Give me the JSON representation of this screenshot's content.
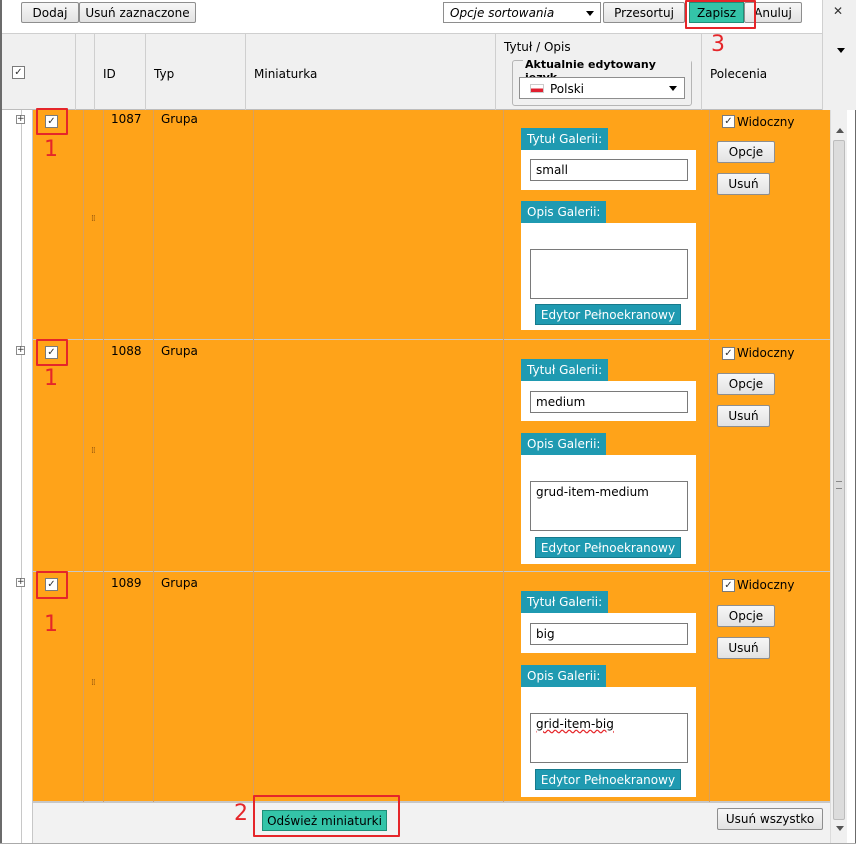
{
  "toolbar": {
    "add_label": "Dodaj",
    "remove_selected_label": "Usuń zaznaczone",
    "sort_options_label": "Opcje sortowania",
    "resort_label": "Przesortuj",
    "save_label": "Zapisz",
    "cancel_label": "Anuluj",
    "close_glyph": "✕"
  },
  "header": {
    "select_all_checked": "✓",
    "col_id": "ID",
    "col_type": "Typ",
    "col_thumbnail": "Miniaturka",
    "col_title_desc": "Tytuł / Opis",
    "lang_group_label": "Aktualnie edytowany język",
    "lang_value": "Polski",
    "col_commands": "Polecenia"
  },
  "rows": [
    {
      "id": "1087",
      "type": "Grupa",
      "title_tab": "Tytuł Galerii:",
      "title_value": "small",
      "desc_tab": "Opis Galerii:",
      "desc_value": "",
      "editor_label": "Edytor Pełnoekranowy",
      "visible_label": "Widoczny",
      "options_label": "Opcje",
      "remove_label": "Usuń",
      "check": "✓",
      "expander": "+",
      "annotation": "1"
    },
    {
      "id": "1088",
      "type": "Grupa",
      "title_tab": "Tytuł Galerii:",
      "title_value": "medium",
      "desc_tab": "Opis Galerii:",
      "desc_value": "grud-item-medium",
      "editor_label": "Edytor Pełnoekranowy",
      "visible_label": "Widoczny",
      "options_label": "Opcje",
      "remove_label": "Usuń",
      "check": "✓",
      "expander": "+",
      "annotation": "1"
    },
    {
      "id": "1089",
      "type": "Grupa",
      "title_tab": "Tytuł Galerii:",
      "title_value": "big",
      "desc_tab": "Opis Galerii:",
      "desc_value": "grid-item-big",
      "editor_label": "Edytor Pełnoekranowy",
      "visible_label": "Widoczny",
      "options_label": "Opcje",
      "remove_label": "Usuń",
      "check": "✓",
      "expander": "+",
      "annotation": "1"
    }
  ],
  "footer": {
    "refresh_thumbnails_label": "Odśwież miniaturki",
    "remove_all_label": "Usuń wszystko"
  },
  "annotations": {
    "refresh": "2",
    "save": "3"
  },
  "colors": {
    "row_bg": "#ffa319",
    "accent_teal": "#1f9ab1",
    "save_green": "#34c4a8",
    "annotation_red": "#e5262a"
  }
}
